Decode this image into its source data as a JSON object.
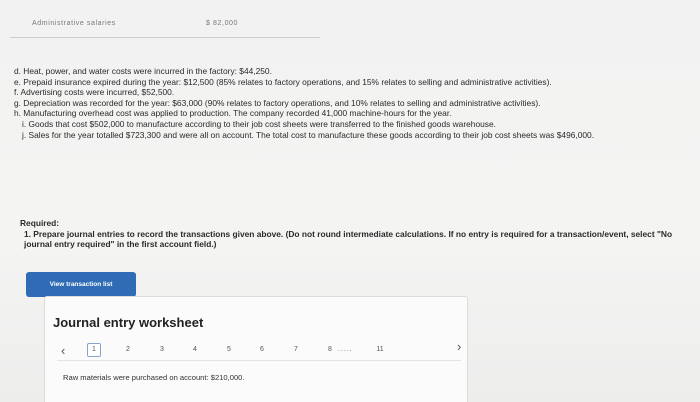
{
  "top_row": {
    "label": "Administrative salaries",
    "value": "$ 82,000"
  },
  "transactions": [
    {
      "text": "d. Heat, power, and water costs were incurred in the factory: $44,250.",
      "sub": false
    },
    {
      "text": "e. Prepaid insurance expired during the year: $12,500 (85% relates to factory operations, and 15% relates to selling and administrative activities).",
      "sub": false
    },
    {
      "text": "f. Advertising costs were incurred, $52,500.",
      "sub": false
    },
    {
      "text": "g. Depreciation was recorded for the year: $63,000 (90% relates to factory operations, and 10% relates to selling and administrative activities).",
      "sub": false
    },
    {
      "text": "h. Manufacturing overhead cost was applied to production. The company recorded 41,000 machine-hours for the year.",
      "sub": false
    },
    {
      "text": "i. Goods that cost $502,000 to manufacture according to their job cost sheets were transferred to the finished goods warehouse.",
      "sub": true
    },
    {
      "text": "j. Sales for the year totalled $723,300 and were all on account. The total cost to manufacture these goods according to their job cost sheets was $496,000.",
      "sub": true
    }
  ],
  "required": {
    "heading": "Required:",
    "item_prefix": "1. Prepare journal entries to record the transactions given above.",
    "item_bold": "(Do not round intermediate calculations. If no entry is required for a transaction/event, select \"No journal entry required\" in the first account field.)"
  },
  "view_button": "View transaction list",
  "worksheet": {
    "title": "Journal entry worksheet",
    "prev_icon": "chevron-left-icon",
    "next_icon": "chevron-right-icon",
    "pages": [
      "1",
      "2",
      "3",
      "4",
      "5",
      "6",
      "7",
      "8"
    ],
    "active_page": "1",
    "ellipsis": ".....",
    "last_page": "11",
    "transaction_text": "Raw materials were purchased on account: $210,000."
  }
}
